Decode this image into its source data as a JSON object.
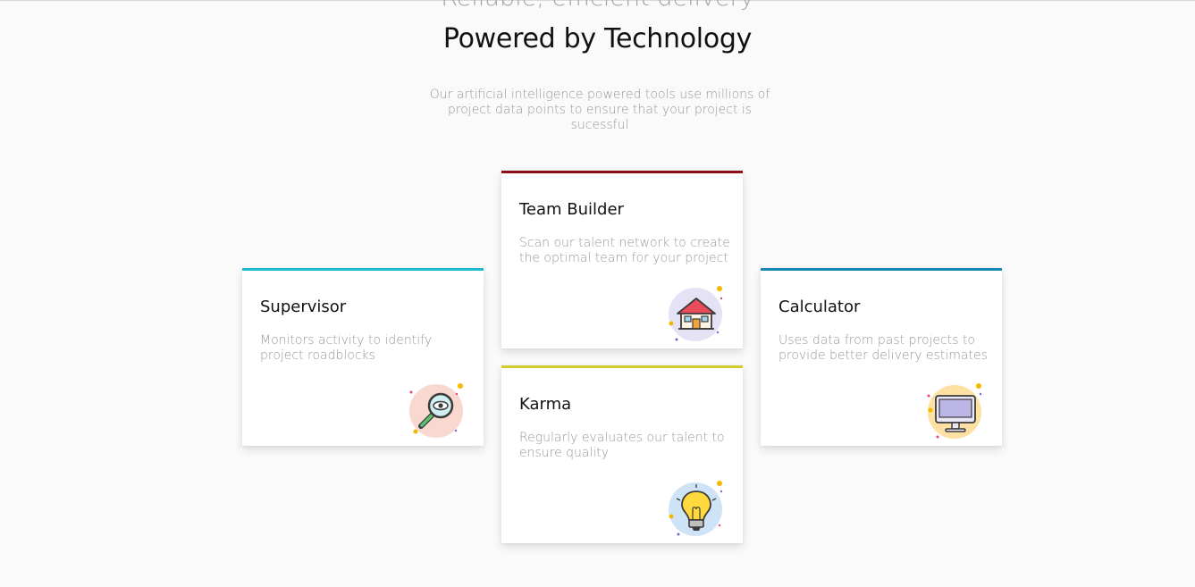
{
  "section": {
    "kicker": "Reliable, efficient delivery",
    "headline": "Powered by Technology",
    "subtitle": "Our artificial intelligence powered tools use millions of project data points to ensure that your project is sucessful"
  },
  "cards": {
    "supervisor": {
      "title": "Supervisor",
      "description": "Monitors activity to identify project roadblocks",
      "accent": "#1fb9d1",
      "icon": "magnifier-eye-icon"
    },
    "teambuilder": {
      "title": "Team Builder",
      "description": "Scan our talent network to create the optimal team for your project",
      "accent": "#8a0e16",
      "icon": "house-icon"
    },
    "karma": {
      "title": "Karma",
      "description": "Regularly evaluates our talent to ensure quality",
      "accent": "#cfce2d",
      "icon": "lightbulb-icon"
    },
    "calculator": {
      "title": "Calculator",
      "description": "Uses data from past projects to provide better delivery estimates",
      "accent": "#1a87b5",
      "icon": "monitor-icon"
    }
  }
}
